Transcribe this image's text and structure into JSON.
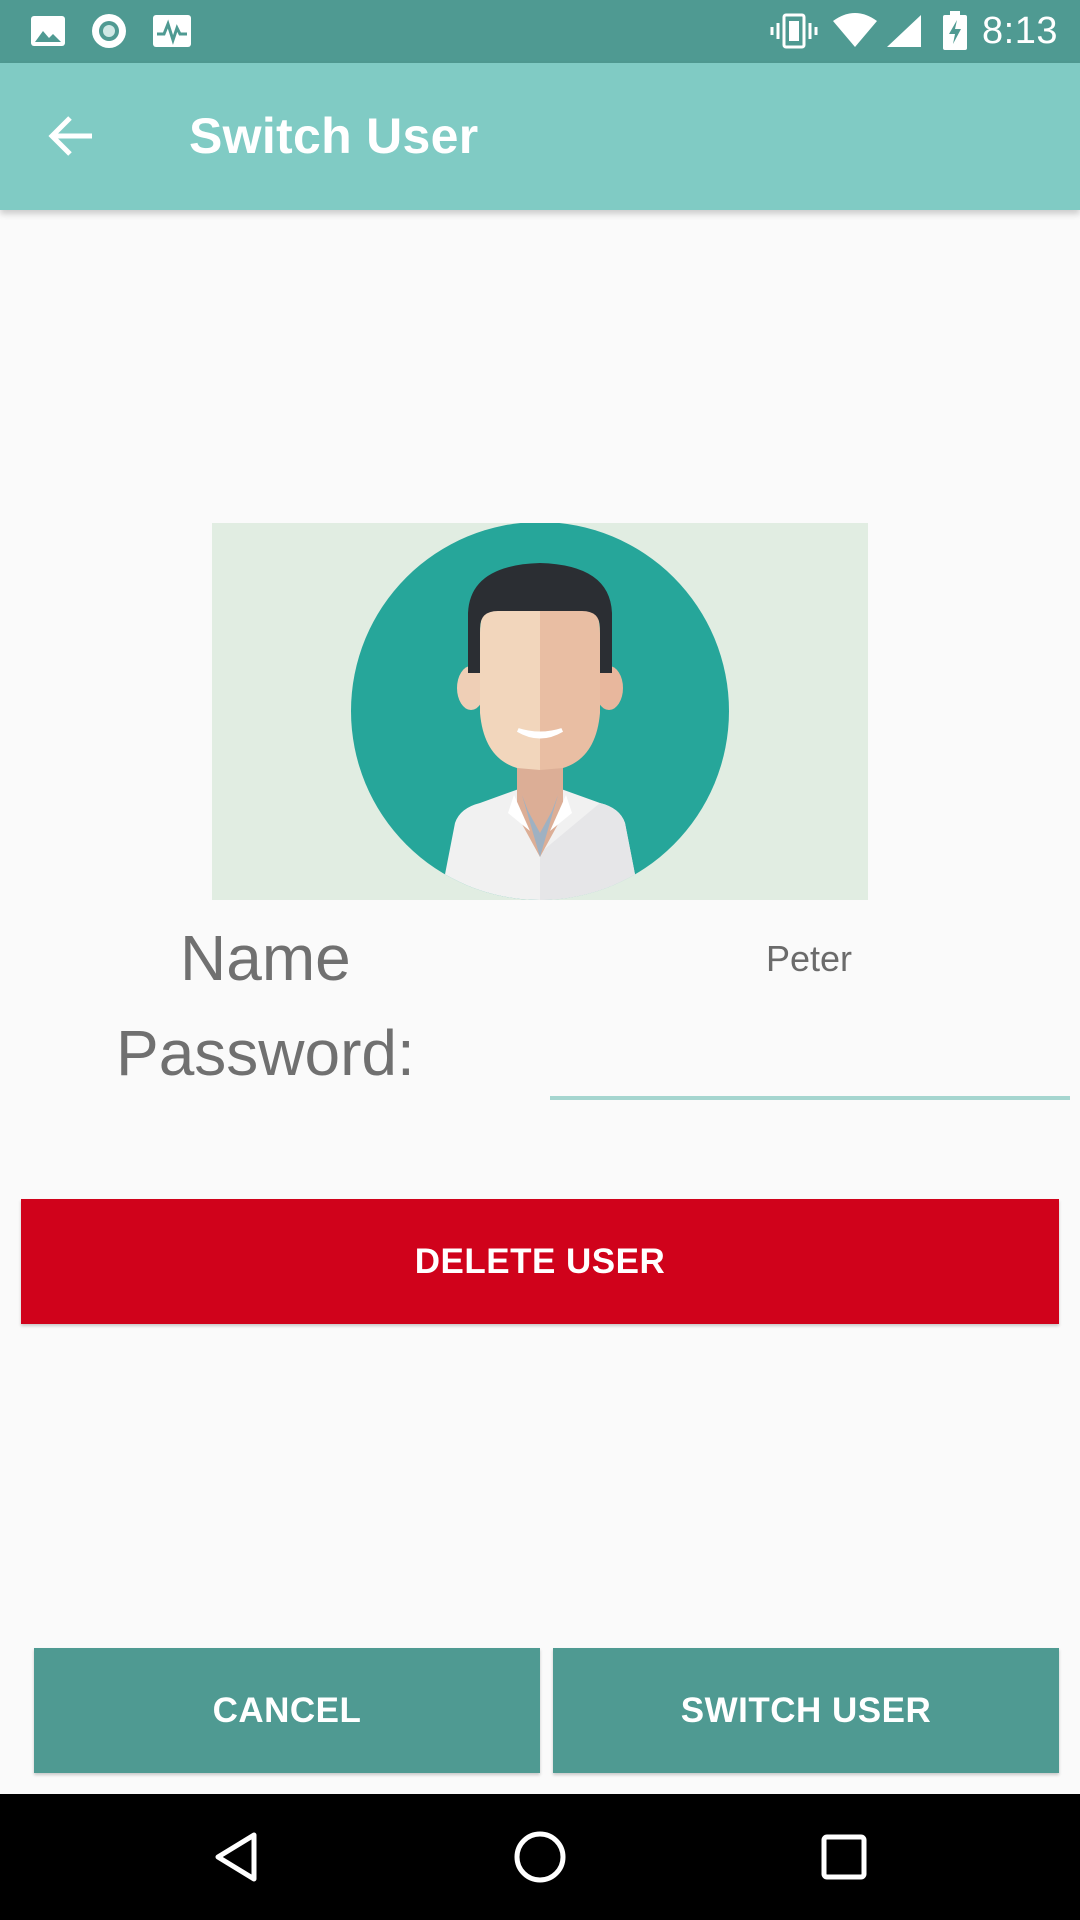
{
  "status_bar": {
    "time": "8:13",
    "icons": [
      "image-icon",
      "circle-record-icon",
      "activity-icon",
      "vibrate-icon",
      "wifi-icon",
      "signal-icon",
      "battery-charging-icon"
    ]
  },
  "app_bar": {
    "title": "Switch User",
    "back_icon": "arrow-left-icon"
  },
  "profile": {
    "avatar_icon": "user-avatar-icon",
    "name_label": "Name",
    "name_value": "Peter",
    "password_label": "Password:",
    "password_value": "",
    "password_placeholder": ""
  },
  "actions": {
    "delete_label": "DELETE USER",
    "cancel_label": "CANCEL",
    "switch_label": "SWITCH USER"
  },
  "nav_bar": {
    "icons": [
      "back-triangle-icon",
      "home-circle-icon",
      "recents-square-icon"
    ]
  },
  "colors": {
    "status_bar": "#4f9a92",
    "app_bar": "#80cbc4",
    "delete_button": "#d0021b",
    "primary_button": "#4f9a92",
    "avatar_background": "#e1ede2",
    "avatar_circle": "#26a69a"
  }
}
